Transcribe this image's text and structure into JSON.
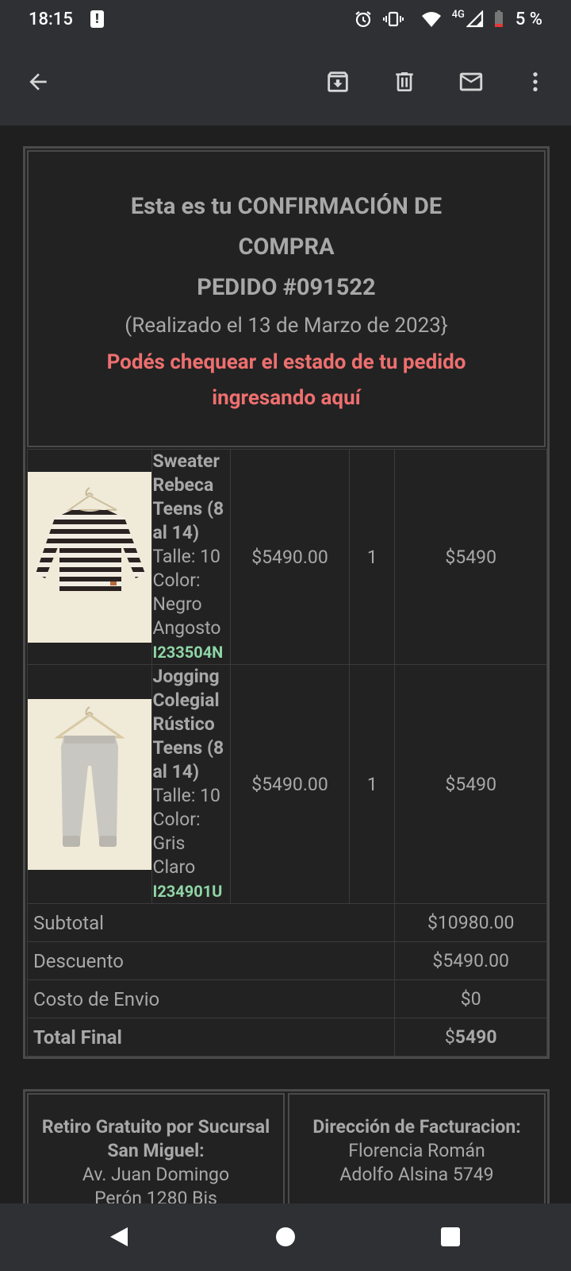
{
  "status": {
    "time": "18:15",
    "network": "4G",
    "battery": "5 %"
  },
  "appbar": {
    "back_icon": "arrow-back-icon",
    "archive_icon": "archive-icon",
    "delete_icon": "trash-icon",
    "mark_unread_icon": "mail-icon",
    "more_icon": "more-vert-icon"
  },
  "email": {
    "headline_1": "Esta es tu CONFIRMACIÓN DE",
    "headline_2": "COMPRA",
    "order_number": "PEDIDO #091522",
    "placed_on": "(Realizado el 13 de Marzo de 2023}",
    "check_link_1": "Podés chequear el estado de tu pedido",
    "check_link_2": "ingresando aquí",
    "items": [
      {
        "name": "Sweater Rebeca Teens (8 al 14)",
        "size": "Talle: 10",
        "color": "Color: Negro Angosto",
        "sku": "I233504N",
        "price": "$5490.00",
        "qty": "1",
        "total": "$5490"
      },
      {
        "name": "Jogging Colegial Rústico Teens (8 al 14)",
        "size": "Talle: 10",
        "color": "Color: Gris Claro",
        "sku": "I234901U",
        "price": "$5490.00",
        "qty": "1",
        "total": "$5490"
      }
    ],
    "summary": {
      "subtotal_label": "Subtotal",
      "subtotal_value": "$10980.00",
      "discount_label": "Descuento",
      "discount_value": "$5490.00",
      "shipping_label": "Costo de Envio",
      "shipping_value": "$0",
      "total_label": "Total Final",
      "total_currency": "$",
      "total_value": "5490"
    },
    "pickup": {
      "title": "Retiro Gratuito por Sucursal San Miguel:",
      "line1": "Av. Juan Domingo",
      "line2": "Perón 1280 Bis"
    },
    "billing": {
      "title": "Dirección de Facturacion:",
      "line1": "Florencia Román",
      "line2": "Adolfo Alsina 5749"
    }
  },
  "colors": {
    "bars": "#2e3034",
    "background": "#1f1f1f",
    "text": "#a8a8a8",
    "link": "#ef6f6f",
    "sku": "#8fd5a6"
  }
}
